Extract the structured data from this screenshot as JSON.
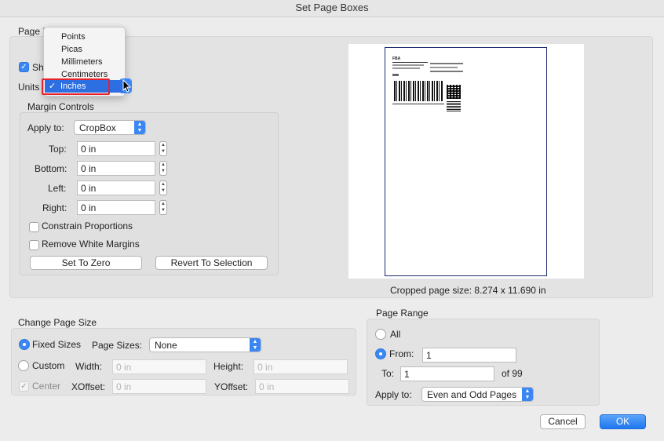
{
  "window": {
    "title": "Set Page Boxes"
  },
  "page_boxes": {
    "heading": "Page B",
    "show_label": "Sho",
    "units_label": "Units",
    "units_menu": {
      "options": [
        "Points",
        "Picas",
        "Millimeters",
        "Centimeters",
        "Inches"
      ],
      "selected": "Inches",
      "checkmark": "✓"
    }
  },
  "margin_controls": {
    "heading": "Margin Controls",
    "apply_to_label": "Apply to:",
    "apply_to_value": "CropBox",
    "top_label": "Top:",
    "top_value": "0 in",
    "bottom_label": "Bottom:",
    "bottom_value": "0 in",
    "left_label": "Left:",
    "left_value": "0 in",
    "right_label": "Right:",
    "right_value": "0 in",
    "constrain_label": "Constrain Proportions",
    "remove_white_label": "Remove White Margins",
    "set_zero_label": "Set To Zero",
    "revert_label": "Revert To Selection"
  },
  "preview": {
    "cropped_size_text": "Cropped page size: 8.274 x 11.690 in",
    "label_header": "FBA"
  },
  "change_page_size": {
    "heading": "Change Page Size",
    "fixed_sizes_label": "Fixed Sizes",
    "page_sizes_label": "Page Sizes:",
    "page_sizes_value": "None",
    "custom_label": "Custom",
    "width_label": "Width:",
    "width_placeholder": "0 in",
    "height_label": "Height:",
    "height_placeholder": "0 in",
    "center_label": "Center",
    "xoffset_label": "XOffset:",
    "xoffset_placeholder": "0 in",
    "yoffset_label": "YOffset:",
    "yoffset_placeholder": "0 in"
  },
  "page_range": {
    "heading": "Page Range",
    "all_label": "All",
    "from_label": "From:",
    "from_value": "1",
    "to_label": "To:",
    "to_value": "1",
    "of_text": "of 99",
    "apply_to_label": "Apply to:",
    "apply_to_value": "Even and Odd Pages"
  },
  "footer": {
    "cancel_label": "Cancel",
    "ok_label": "OK"
  },
  "colors": {
    "accent": "#3b87f4",
    "highlight_box": "#e8212a",
    "selected_menu": "#2d6fe3"
  }
}
